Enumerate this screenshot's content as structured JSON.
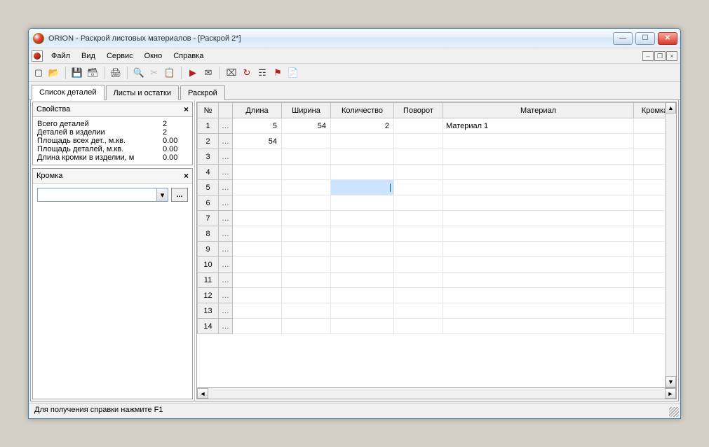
{
  "title": "ORION - Раскрой листовых материалов - [Раскрой 2*]",
  "menu": {
    "file": "Файл",
    "view": "Вид",
    "service": "Сервис",
    "window": "Окно",
    "help": "Справка"
  },
  "tabs": {
    "t1": "Список деталей",
    "t2": "Листы и остатки",
    "t3": "Раскрой"
  },
  "props": {
    "title": "Свойства",
    "r1l": "Всего деталей",
    "r1v": "2",
    "r2l": "Деталей в изделии",
    "r2v": "2",
    "r3l": "Площадь всех дет., м.кв.",
    "r3v": "0.00",
    "r4l": "Площадь деталей, м.кв.",
    "r4v": "0.00",
    "r5l": "Длина кромки в изделии, м",
    "r5v": "0.00"
  },
  "edge": {
    "title": "Кромка",
    "dots": "..."
  },
  "columns": {
    "c0": "№",
    "c1": "Длина",
    "c2": "Ширина",
    "c3": "Количество",
    "c4": "Поворот",
    "c5": "Материал",
    "c6": "Кромка"
  },
  "rows": [
    {
      "n": "1",
      "len": "5",
      "wid": "54",
      "qty": "2",
      "rot": "",
      "mat": "Материал 1",
      "edge": ""
    },
    {
      "n": "2",
      "len": "54",
      "wid": "",
      "qty": "",
      "rot": "",
      "mat": "",
      "edge": ""
    },
    {
      "n": "3"
    },
    {
      "n": "4"
    },
    {
      "n": "5",
      "cursor": true
    },
    {
      "n": "6"
    },
    {
      "n": "7"
    },
    {
      "n": "8"
    },
    {
      "n": "9"
    },
    {
      "n": "10"
    },
    {
      "n": "11"
    },
    {
      "n": "12"
    },
    {
      "n": "13"
    },
    {
      "n": "14"
    }
  ],
  "ellipsis": "…",
  "status": "Для получения справки нажмите F1"
}
